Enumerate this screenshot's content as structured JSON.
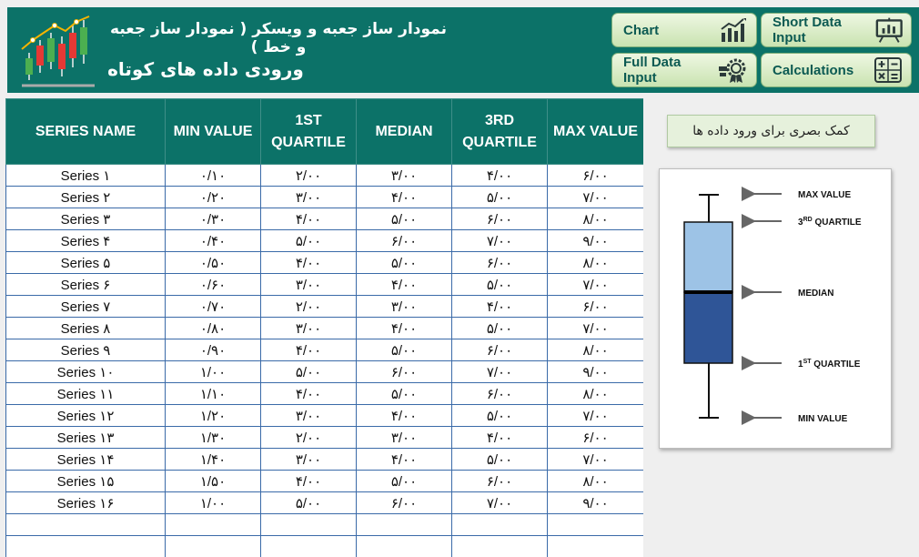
{
  "header": {
    "title": "نمودار ساز جعبه و ویسکر ( نمودار ساز جعبه و خط )",
    "subtitle": "ورودی داده های کوتاه",
    "buttons": {
      "chart": "Chart",
      "short_data_input": "Short Data Input",
      "full_data_input": "Full Data Input",
      "calculations": "Calculations"
    }
  },
  "table": {
    "columns": [
      "SERIES NAME",
      "MIN VALUE",
      "1ST",
      "QUARTILE",
      "MEDIAN",
      "3RD",
      "QUARTILE",
      "MAX VALUE"
    ],
    "rows": [
      [
        "Series ۱",
        "۰/۱۰",
        "۲/۰۰",
        "۳/۰۰",
        "۴/۰۰",
        "۶/۰۰"
      ],
      [
        "Series ۲",
        "۰/۲۰",
        "۳/۰۰",
        "۴/۰۰",
        "۵/۰۰",
        "۷/۰۰"
      ],
      [
        "Series ۳",
        "۰/۳۰",
        "۴/۰۰",
        "۵/۰۰",
        "۶/۰۰",
        "۸/۰۰"
      ],
      [
        "Series ۴",
        "۰/۴۰",
        "۵/۰۰",
        "۶/۰۰",
        "۷/۰۰",
        "۹/۰۰"
      ],
      [
        "Series ۵",
        "۰/۵۰",
        "۴/۰۰",
        "۵/۰۰",
        "۶/۰۰",
        "۸/۰۰"
      ],
      [
        "Series ۶",
        "۰/۶۰",
        "۳/۰۰",
        "۴/۰۰",
        "۵/۰۰",
        "۷/۰۰"
      ],
      [
        "Series ۷",
        "۰/۷۰",
        "۲/۰۰",
        "۳/۰۰",
        "۴/۰۰",
        "۶/۰۰"
      ],
      [
        "Series ۸",
        "۰/۸۰",
        "۳/۰۰",
        "۴/۰۰",
        "۵/۰۰",
        "۷/۰۰"
      ],
      [
        "Series ۹",
        "۰/۹۰",
        "۴/۰۰",
        "۵/۰۰",
        "۶/۰۰",
        "۸/۰۰"
      ],
      [
        "Series ۱۰",
        "۱/۰۰",
        "۵/۰۰",
        "۶/۰۰",
        "۷/۰۰",
        "۹/۰۰"
      ],
      [
        "Series ۱۱",
        "۱/۱۰",
        "۴/۰۰",
        "۵/۰۰",
        "۶/۰۰",
        "۸/۰۰"
      ],
      [
        "Series ۱۲",
        "۱/۲۰",
        "۳/۰۰",
        "۴/۰۰",
        "۵/۰۰",
        "۷/۰۰"
      ],
      [
        "Series ۱۳",
        "۱/۳۰",
        "۲/۰۰",
        "۳/۰۰",
        "۴/۰۰",
        "۶/۰۰"
      ],
      [
        "Series ۱۴",
        "۱/۴۰",
        "۳/۰۰",
        "۴/۰۰",
        "۵/۰۰",
        "۷/۰۰"
      ],
      [
        "Series ۱۵",
        "۱/۵۰",
        "۴/۰۰",
        "۵/۰۰",
        "۶/۰۰",
        "۸/۰۰"
      ],
      [
        "Series ۱۶",
        "۱/۰۰",
        "۵/۰۰",
        "۶/۰۰",
        "۷/۰۰",
        "۹/۰۰"
      ],
      [
        "",
        "",
        "",
        "",
        "",
        ""
      ],
      [
        "",
        "",
        "",
        "",
        "",
        ""
      ]
    ]
  },
  "help_label": "کمک بصری برای ورود داده ها",
  "diagram": {
    "labels": {
      "max": "MAX VALUE",
      "q3_num": "3",
      "q3_sup": "RD",
      "q3_word": "QUARTILE",
      "median": "MEDIAN",
      "q1_num": "1",
      "q1_sup": "ST",
      "q1_word": "QUARTILE",
      "min": "MIN VALUE"
    },
    "colors": {
      "upper_box": "#9dc3e6",
      "lower_box": "#2f5597"
    }
  },
  "colors": {
    "header_bg": "#0c7268",
    "button_text": "#0c5a52",
    "table_border": "#3a6aa8"
  },
  "icons": {
    "logo": "candlestick-chart-icon",
    "chart": "bar-line-chart-icon",
    "short": "presentation-board-icon",
    "full": "gear-award-icon",
    "calc": "calculator-icon"
  }
}
